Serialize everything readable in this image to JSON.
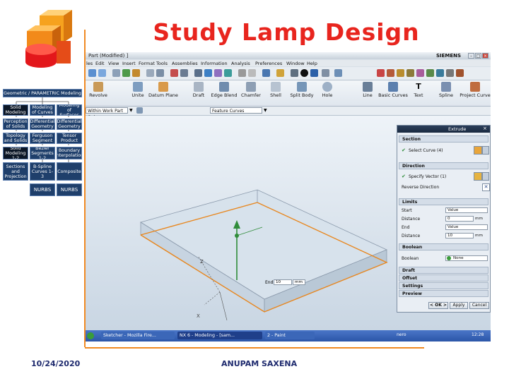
{
  "slide": {
    "title": "Study Lamp Design",
    "footer_date": "10/24/2020",
    "footer_author": "ANUPAM SAXENA"
  },
  "hierarchy": {
    "root": "Geometric / PARAMETRIC Modeling",
    "nodes": {
      "solid_modeling": "Solid Modeling",
      "modeling_of_curves": "Modeling of Curves",
      "modeling_of_surfaces": "Modeling of Surfaces",
      "perception_of_solids": "Perception of Solids",
      "differential_geometry_curves": "Differential Geometry",
      "differential_geometry_surfaces": "Differential Geometry",
      "topology_and_solids": "Topology and Solids",
      "ferguson_segment": "Ferguson Segment",
      "tensor_product": "Tensor Product",
      "solid_modeling_1_2": "Solid Modeling 1-2",
      "bezier_segments": "Bezier Segments 1-2",
      "boundary_interpolation": "Boundary Interpolation",
      "sections_and_projection": "Sections and Projection",
      "b_spline_curves": "B-Spline Curves 1-3",
      "composite": "Composite",
      "nurbs_curves": "NURBS",
      "nurbs_surfaces": "NURBS"
    }
  },
  "nx": {
    "window_title": "Part (Modified) ]",
    "brand": "SIEMENS",
    "menu": [
      "les",
      "Edit",
      "View",
      "Insert",
      "Format",
      "Tools",
      "Assemblies",
      "Information",
      "Analysis",
      "Preferences",
      "Window",
      "Help"
    ],
    "tools": [
      "Revolve",
      "Unite",
      "Datum Plane",
      "Draft",
      "Edge Blend",
      "Chamfer",
      "Shell",
      "Split Body",
      "Hole",
      "Line",
      "Basic Curves",
      "Text",
      "Spline",
      "Project Curve"
    ],
    "filter_scope": "Within Work Part Only",
    "filter_type": "Feature Curves",
    "end_label": "End",
    "end_value": "10",
    "end_unit": "mm",
    "taskbar": [
      "Sketcher - Mozilla Fire...",
      "NX 6 - Modeling - [sam...",
      "2 - Paint"
    ],
    "taskbar_right": "nero",
    "clock": "12:28"
  },
  "extrude": {
    "title": "Extrude",
    "section": {
      "label": "Section",
      "select_curve": "Select Curve (4)"
    },
    "direction": {
      "label": "Direction",
      "specify_vector": "Specify Vector (1)",
      "reverse": "Reverse Direction"
    },
    "limits": {
      "label": "Limits",
      "start_label": "Start",
      "start_value": "Value",
      "start_distance_label": "Distance",
      "start_distance": "0",
      "unit": "mm",
      "end_label": "End",
      "end_value": "Value",
      "end_distance_label": "Distance",
      "end_distance": "10"
    },
    "boolean": {
      "label": "Boolean",
      "boolean_label": "Boolean",
      "value": "None"
    },
    "collapsed": [
      "Draft",
      "Offset",
      "Settings",
      "Preview"
    ],
    "ok": "< OK >",
    "apply": "Apply",
    "cancel": "Cancel"
  },
  "colors": {
    "title_red": "#e8251e",
    "accent_orange": "#f08a22",
    "box_navy": "#1f3f6b",
    "footer_navy": "#1e2a6e"
  }
}
